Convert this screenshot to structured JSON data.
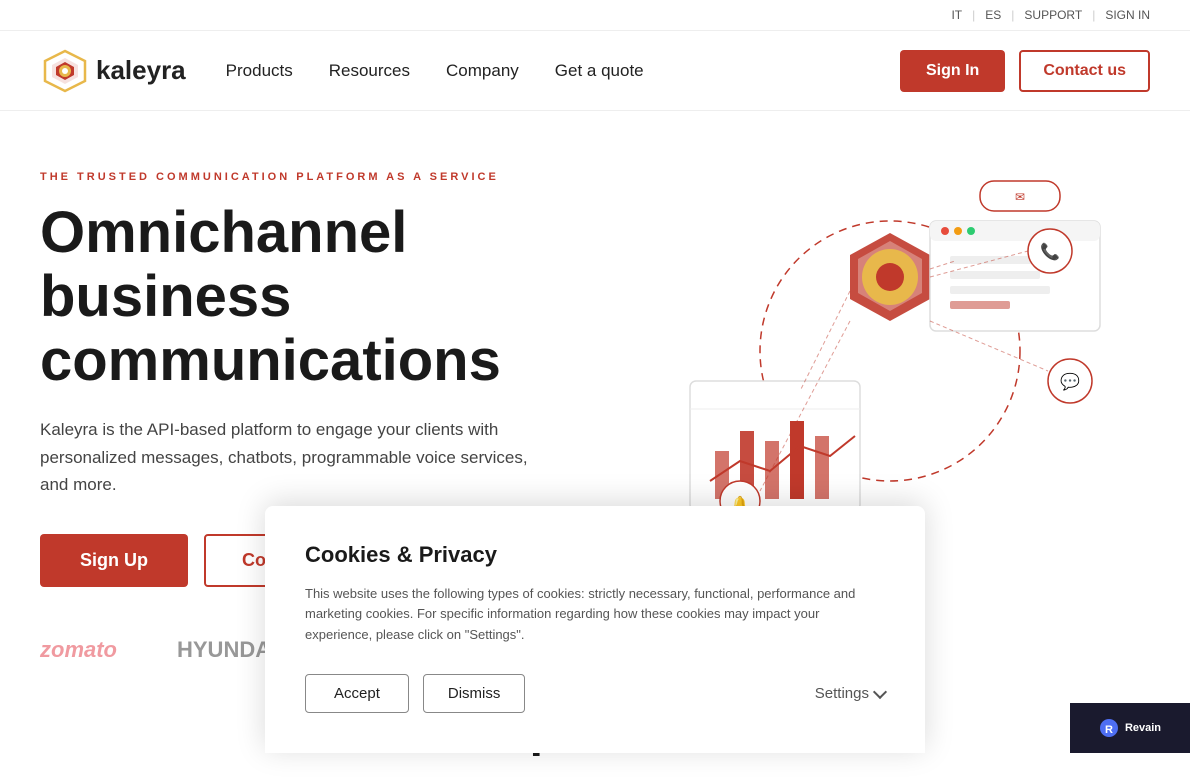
{
  "topbar": {
    "links": [
      "IT",
      "ES",
      "SUPPORT",
      "SIGN IN"
    ],
    "separators": [
      "|",
      "|",
      "|"
    ]
  },
  "navbar": {
    "logo_text": "kaleyra",
    "links": [
      "Products",
      "Resources",
      "Company",
      "Get a quote"
    ],
    "signin_label": "Sign In",
    "contact_label": "Contact us"
  },
  "hero": {
    "tag": "THE TRUSTED COMMUNICATION PLATFORM AS A SERVICE",
    "title": "Omnichannel business communications",
    "description": "Kaleyra is the API-based platform to engage your clients with personalized messages, chatbots, programmable voice services, and more.",
    "signup_label": "Sign Up",
    "contactus_label": "Contact Us"
  },
  "brands": {
    "logos": [
      "zomato",
      "HYUNDAI"
    ]
  },
  "experiences": {
    "title_suffix": "xperiences"
  },
  "cookie": {
    "title": "Cookies & Privacy",
    "description": "This website uses the following types of cookies: strictly necessary, functional, performance and marketing cookies. For specific information regarding how these cookies may impact your experience, please click on \"Settings\".",
    "accept_label": "Accept",
    "dismiss_label": "Dismiss",
    "settings_label": "Settings"
  }
}
